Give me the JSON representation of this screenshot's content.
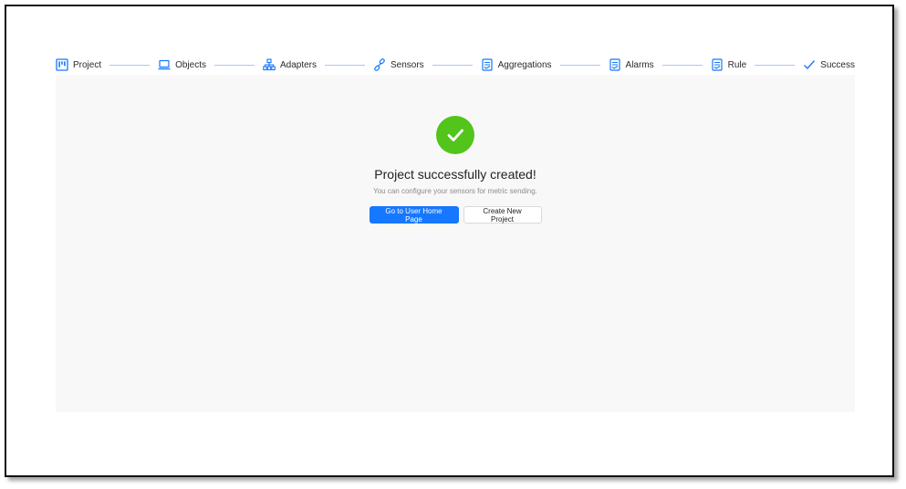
{
  "steps": [
    {
      "label": "Project",
      "icon": "project-board-icon"
    },
    {
      "label": "Objects",
      "icon": "laptop-icon"
    },
    {
      "label": "Adapters",
      "icon": "cluster-icon"
    },
    {
      "label": "Sensors",
      "icon": "link-icon"
    },
    {
      "label": "Aggregations",
      "icon": "document-icon"
    },
    {
      "label": "Alarms",
      "icon": "document-icon"
    },
    {
      "label": "Rule",
      "icon": "document-icon"
    },
    {
      "label": "Success",
      "icon": "check-icon"
    }
  ],
  "result": {
    "title": "Project successfully created!",
    "subtitle": "You can configure your sensors for metric sending.",
    "status_icon": "check-circle-icon",
    "primary_button": "Go to User Home Page",
    "secondary_button": "Create New Project"
  },
  "colors": {
    "accent": "#1677ff",
    "success": "#52c41a",
    "step_line": "#a9c7ee",
    "content_bg": "#f8f8f8"
  }
}
